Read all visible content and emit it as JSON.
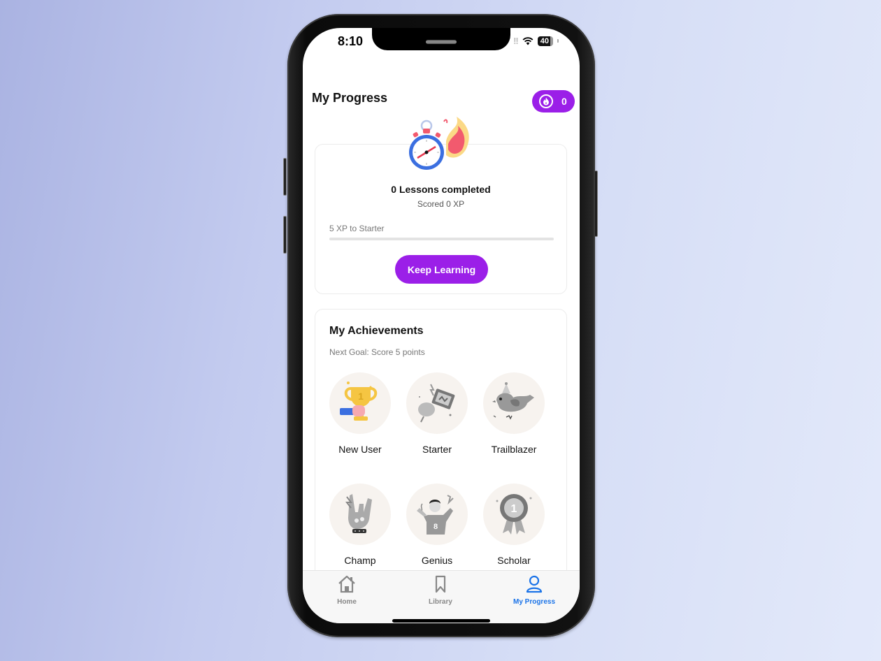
{
  "status_bar": {
    "time": "8:10",
    "battery": "40",
    "signal": "!!"
  },
  "header": {
    "title": "My Progress",
    "streak_count": "0"
  },
  "progress_card": {
    "lessons_completed": "0 Lessons completed",
    "scored": "Scored 0 XP",
    "xp_to_next": "5 XP to Starter",
    "progress_fraction": 0,
    "button_label": "Keep Learning"
  },
  "achievements": {
    "title": "My Achievements",
    "next_goal": "Next Goal: Score 5 points",
    "badges": [
      {
        "label": "New User",
        "icon": "trophy-icon",
        "unlocked": true
      },
      {
        "label": "Starter",
        "icon": "fist-badge-icon",
        "unlocked": false
      },
      {
        "label": "Trailblazer",
        "icon": "bird-icon",
        "unlocked": false
      },
      {
        "label": "Champ",
        "icon": "rock-hand-icon",
        "unlocked": false
      },
      {
        "label": "Genius",
        "icon": "person-cheer-icon",
        "unlocked": false
      },
      {
        "label": "Scholar",
        "icon": "medal-ribbon-icon",
        "unlocked": false
      }
    ]
  },
  "tabbar": {
    "items": [
      {
        "label": "Home",
        "icon": "home-icon",
        "active": false
      },
      {
        "label": "Library",
        "icon": "bookmark-icon",
        "active": false
      },
      {
        "label": "My Progress",
        "icon": "person-icon",
        "active": true
      }
    ]
  },
  "colors": {
    "accent": "#9b1fe8",
    "tab_active": "#1a73e8",
    "background": "#c3cbef"
  }
}
